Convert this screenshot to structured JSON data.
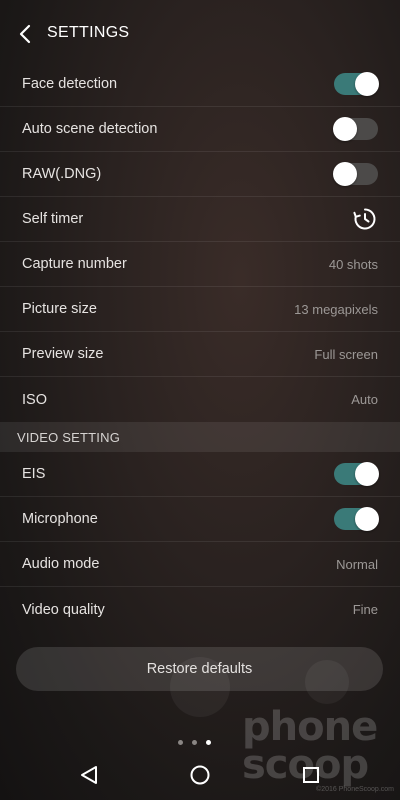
{
  "header": {
    "title": "SETTINGS"
  },
  "settings": [
    {
      "label": "Face detection",
      "type": "toggle",
      "state": "on"
    },
    {
      "label": "Auto scene detection",
      "type": "toggle",
      "state": "off"
    },
    {
      "label": "RAW(.DNG)",
      "type": "toggle",
      "state": "off"
    },
    {
      "label": "Self timer",
      "type": "icon",
      "icon": "timer-icon"
    },
    {
      "label": "Capture number",
      "type": "value",
      "value": "40 shots"
    },
    {
      "label": "Picture size",
      "type": "value",
      "value": "13 megapixels"
    },
    {
      "label": "Preview size",
      "type": "value",
      "value": "Full screen"
    },
    {
      "label": "ISO",
      "type": "value",
      "value": "Auto"
    }
  ],
  "video_section": {
    "title": "VIDEO SETTING"
  },
  "video_settings": [
    {
      "label": "EIS",
      "type": "toggle",
      "state": "on"
    },
    {
      "label": "Microphone",
      "type": "toggle",
      "state": "on"
    },
    {
      "label": "Audio mode",
      "type": "value",
      "value": "Normal"
    },
    {
      "label": "Video quality",
      "type": "value",
      "value": "Fine"
    }
  ],
  "restore_button": {
    "label": "Restore defaults"
  },
  "page_indicator": {
    "count": 3,
    "active_index": 2
  },
  "watermark": {
    "brand": "phone scoop",
    "lines": [
      "phone",
      "scoop"
    ],
    "copyright": "©2016 PhoneScoop.com"
  },
  "colors": {
    "toggle_on": "#3a7a78",
    "toggle_off": "#4c4a49",
    "knob": "#ffffff"
  },
  "navbar": {
    "icons": [
      "back-icon",
      "home-icon",
      "recents-icon"
    ]
  }
}
